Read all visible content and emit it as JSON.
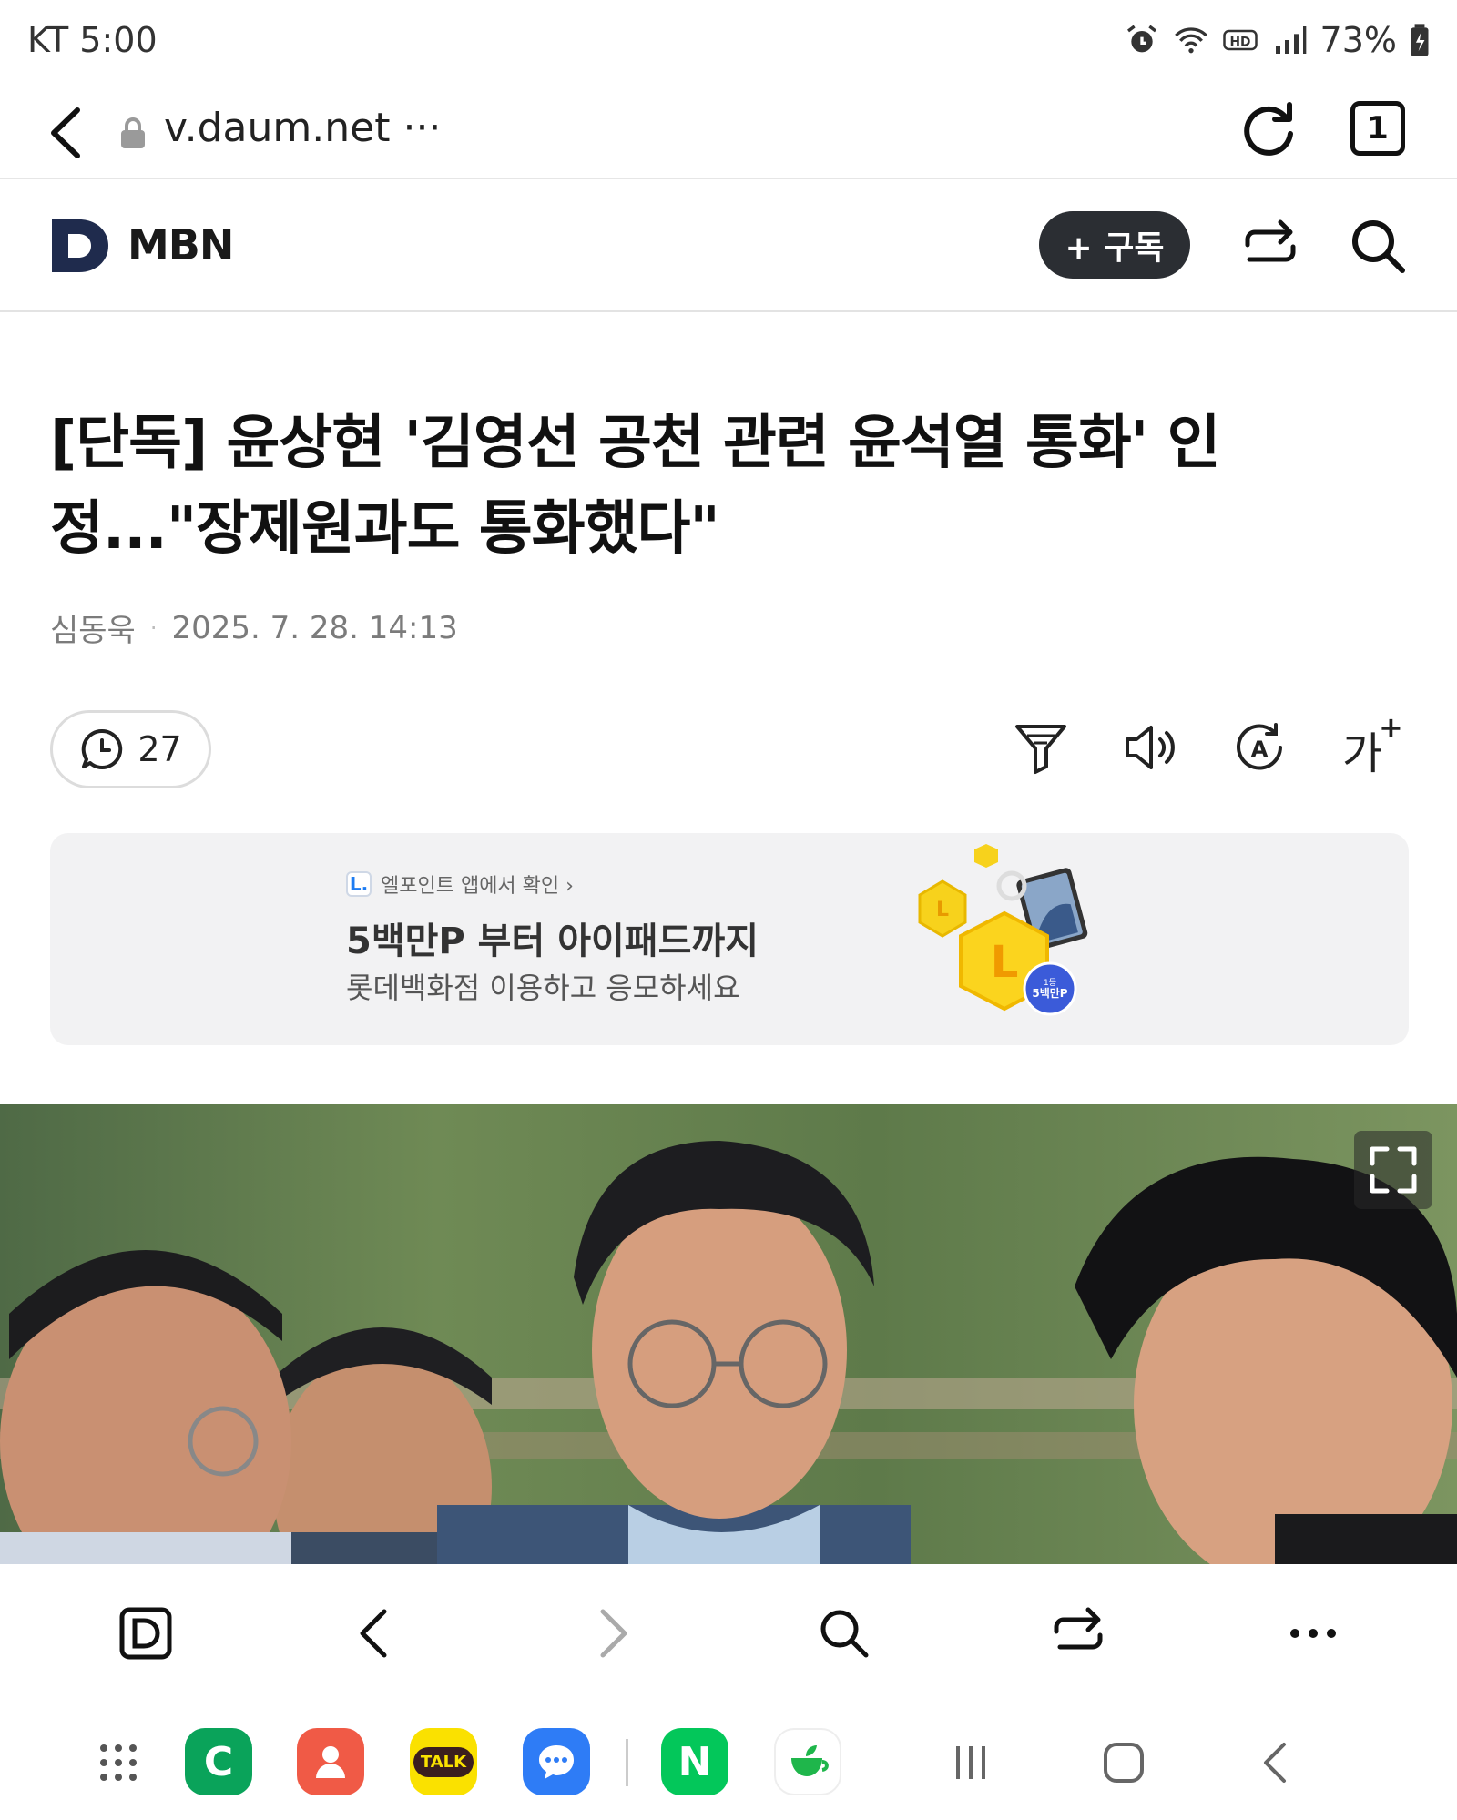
{
  "status_bar": {
    "carrier": "KT",
    "time": "5:00",
    "battery": "73%"
  },
  "url_bar": {
    "url": "v.daum.net",
    "more": "···",
    "tab_count": "1"
  },
  "site_header": {
    "press": "MBN",
    "subscribe_label": "+ 구독"
  },
  "article": {
    "headline_line1": "[단독] 윤상현 '김영선 공천 관련 윤석열 통화' 인",
    "headline_line2": "정...\"장제원과도 통화했다\"",
    "author": "심동욱",
    "separator": "·",
    "datetime": "2025. 7. 28. 14:13",
    "comment_count": "27",
    "font_size_label": "가",
    "font_size_plus": "+"
  },
  "ad": {
    "badge": "L.",
    "brand_line": "엘포인트 앱에서 확인 ›",
    "title": "5백만P 부터 아이패드까지",
    "subtitle": "롯데백화점 이용하고 응모하세요",
    "seal_line1": "1등",
    "seal_line2": "5백만P"
  },
  "icons": {
    "status": [
      "alarm-icon",
      "wifi-icon",
      "hd-icon",
      "signal-icon",
      "battery-icon"
    ],
    "toolbar": [
      "filter-icon",
      "speaker-icon",
      "translate-icon",
      "font-size-icon"
    ],
    "browser_bar": [
      "daum-home-icon",
      "back-icon",
      "forward-icon",
      "search-icon",
      "share-icon",
      "more-icon"
    ]
  },
  "apps": [
    {
      "name": "app-drawer"
    },
    {
      "name": "app-green-c",
      "label": "C",
      "color": "#0aa35a"
    },
    {
      "name": "app-contacts",
      "color": "#f05a46"
    },
    {
      "name": "app-kakaotalk",
      "label": "TALK",
      "color": "#fae100"
    },
    {
      "name": "app-messages",
      "color": "#2e7cf6"
    },
    {
      "name": "app-naver",
      "label": "N",
      "color": "#03c75a"
    },
    {
      "name": "app-green-cup",
      "color": "#ffffff"
    }
  ],
  "colors": {
    "subscribe_bg": "#2b2e33",
    "ad_bg": "#f2f2f3",
    "brand_navy": "#1f2b4d"
  }
}
